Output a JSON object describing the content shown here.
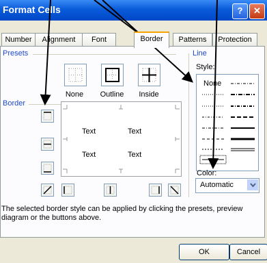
{
  "window": {
    "title": "Format Cells",
    "help_glyph": "?",
    "close_glyph": "✕"
  },
  "tabs": [
    {
      "label": "Number"
    },
    {
      "label": "Alignment"
    },
    {
      "label": "Font"
    },
    {
      "label": "Border",
      "active": true
    },
    {
      "label": "Patterns"
    },
    {
      "label": "Protection"
    }
  ],
  "presets": {
    "group_label": "Presets",
    "items": [
      {
        "label": "None"
      },
      {
        "label": "Outline"
      },
      {
        "label": "Inside"
      }
    ]
  },
  "border": {
    "group_label": "Border",
    "preview_texts": [
      "Text",
      "Text",
      "Text",
      "Text"
    ]
  },
  "line": {
    "group_label": "Line",
    "style_label": "Style:",
    "style_none": "None",
    "color_label": "Color:",
    "color_value": "Automatic"
  },
  "description": "The selected border style can be applied by clicking the presets, preview diagram or the buttons above.",
  "buttons": {
    "ok": "OK",
    "cancel": "Cancel"
  },
  "colors": {
    "accent": "#0a5bd9",
    "group_label": "#1e48c5",
    "active_tab": "#f7a400"
  }
}
